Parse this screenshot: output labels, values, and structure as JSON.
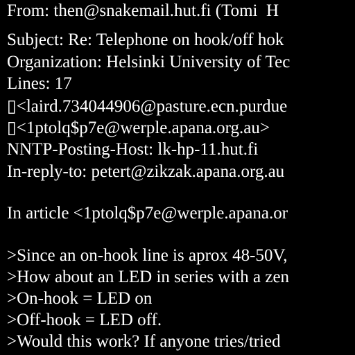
{
  "email": {
    "lines": [
      "From: then@snakemail.hut.fi (Tomi  H",
      "Subject: Re: Telephone on hook/off hok",
      "Organization: Helsinki University of Tec",
      "Lines: 17",
      "▯<laird.734044906@pasture.ecn.purdue",
      "▯<1ptolq$p7e@werple.apana.org.au>",
      "NNTP-Posting-Host: lk-hp-11.hut.fi",
      "In-reply-to: petert@zikzak.apana.org.au",
      "",
      "In article <1ptolq$p7e@werple.apana.or",
      "",
      ">Since an on-hook line is aprox 48-50V,",
      ">How about an LED in series with a zen",
      ">On-hook = LED on",
      ">Off-hook = LED off.",
      ">Would this work? If anyone tries/tried"
    ]
  },
  "colors": {
    "background": "#000000",
    "text": "#ffffff"
  }
}
